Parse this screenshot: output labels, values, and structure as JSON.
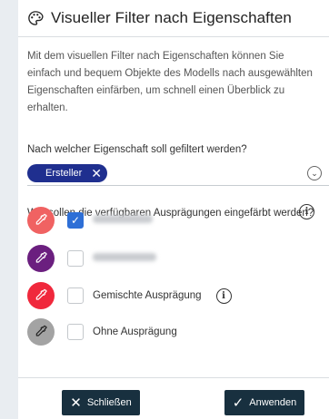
{
  "dialog": {
    "title": "Visueller Filter nach Eigenschaften",
    "description": "Mit dem visuellen Filter nach Eigenschaften können Sie einfach und bequem Objekte des Modells nach ausgewählten Eigenschaften einfärben, um schnell einen Überblick zu erhalten."
  },
  "property_select": {
    "question": "Nach welcher Eigenschaft soll gefiltert werden?",
    "selected_tag": "Ersteller",
    "tag_remove_glyph": "✕",
    "dropdown_glyph": "⌄"
  },
  "values": {
    "question": "Wie sollen die verfügbaren Ausprägungen eingefärbt werden?",
    "info_glyph": "i",
    "rows": [
      {
        "label": "",
        "color": "#f06262",
        "checked": true,
        "blurred": true
      },
      {
        "label": "",
        "color": "#6b1f7f",
        "checked": false,
        "blurred": true
      },
      {
        "label": "Gemischte Ausprägung",
        "color": "#f0283c",
        "checked": false,
        "blurred": false,
        "has_info": true
      },
      {
        "label": "Ohne Ausprägung",
        "color": "#a3a3a3",
        "checked": false,
        "blurred": false
      }
    ]
  },
  "footer": {
    "close_label": "Schließen",
    "close_glyph": "✕",
    "apply_label": "Anwenden",
    "apply_glyph": "✓"
  },
  "icons": {
    "header": "palette-icon",
    "row": "eyedropper-icon"
  }
}
